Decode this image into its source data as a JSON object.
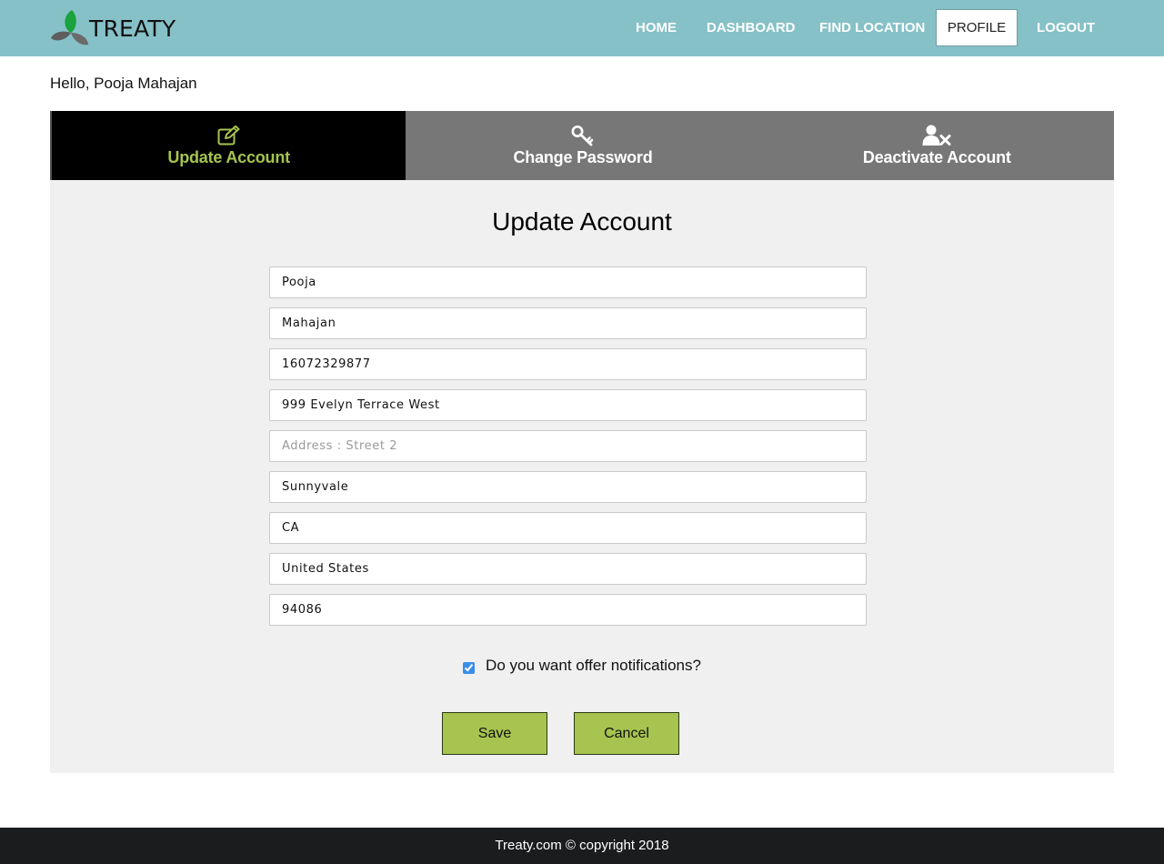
{
  "brand": {
    "name": "TREATY",
    "logo_icon": "three-leaf-logo-icon"
  },
  "nav": {
    "items": [
      {
        "label": "HOME"
      },
      {
        "label": "DASHBOARD"
      },
      {
        "label": "FIND LOCATION"
      },
      {
        "label": "PROFILE",
        "active": true
      },
      {
        "label": "LOGOUT"
      }
    ]
  },
  "greeting": "Hello, Pooja Mahajan",
  "tabs": [
    {
      "label": "Update Account",
      "icon": "edit-icon",
      "active": true
    },
    {
      "label": "Change Password",
      "icon": "key-icon"
    },
    {
      "label": "Deactivate Account",
      "icon": "user-remove-icon"
    }
  ],
  "form": {
    "title": "Update Account",
    "fields": [
      {
        "value": "Pooja",
        "placeholder": ""
      },
      {
        "value": "Mahajan",
        "placeholder": ""
      },
      {
        "value": "16072329877",
        "placeholder": ""
      },
      {
        "value": "999 Evelyn Terrace West",
        "placeholder": ""
      },
      {
        "value": "",
        "placeholder": "Address : Street 2"
      },
      {
        "value": "Sunnyvale",
        "placeholder": ""
      },
      {
        "value": "CA",
        "placeholder": ""
      },
      {
        "value": "United States",
        "placeholder": ""
      },
      {
        "value": "94086",
        "placeholder": ""
      }
    ],
    "notifications_label": "Do you want offer notifications?",
    "notifications_checked": true,
    "save_label": "Save",
    "cancel_label": "Cancel"
  },
  "footer": {
    "text": "Treaty.com © copyright 2018"
  },
  "colors": {
    "navbar": "#85c1c7",
    "accent": "#a6c44f",
    "tab_bar": "#777777",
    "active_tab": "#000000",
    "panel": "#f0f0f0",
    "footer": "#1b1c1d"
  }
}
